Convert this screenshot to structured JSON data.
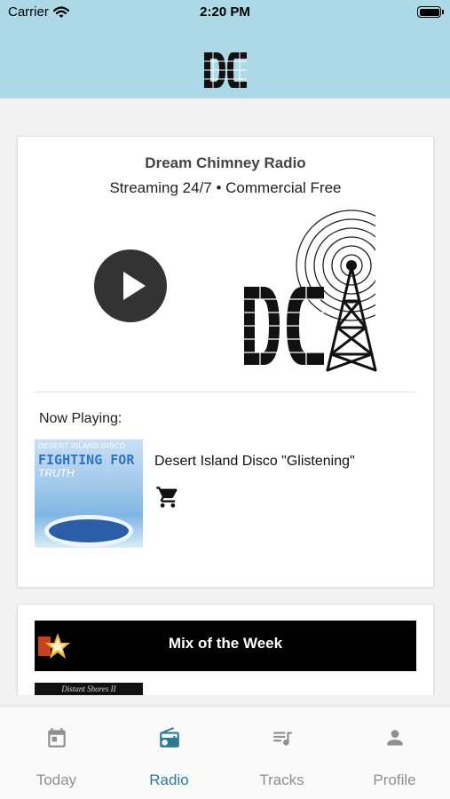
{
  "status_bar": {
    "carrier": "Carrier",
    "time": "2:20 PM"
  },
  "header": {
    "logo_icon": "dc-logo-icon"
  },
  "radio": {
    "title": "Dream Chimney Radio",
    "subtitle": "Streaming 24/7 • Commercial Free",
    "play_icon": "play-icon",
    "now_playing_label": "Now Playing:",
    "track": "Desert Island Disco \"Glistening\"",
    "album_art_lines": [
      "DESERT ISLAND DISCO",
      "FIGHTING FOR",
      "TRUTH"
    ],
    "cart_icon": "shopping-cart-icon"
  },
  "mix": {
    "title": "Mix of the Week",
    "thumb_text": "Distant Shores II"
  },
  "tabs": [
    {
      "label": "Today",
      "icon": "calendar-icon",
      "active": false
    },
    {
      "label": "Radio",
      "icon": "radio-icon",
      "active": true
    },
    {
      "label": "Tracks",
      "icon": "playlist-icon",
      "active": false
    },
    {
      "label": "Profile",
      "icon": "person-icon",
      "active": false
    }
  ],
  "colors": {
    "header_bg": "#add8e6",
    "active_tab": "#2b7a98",
    "inactive_tab": "#8e8e93",
    "play_button": "#333333",
    "banner_bg": "#000000"
  }
}
